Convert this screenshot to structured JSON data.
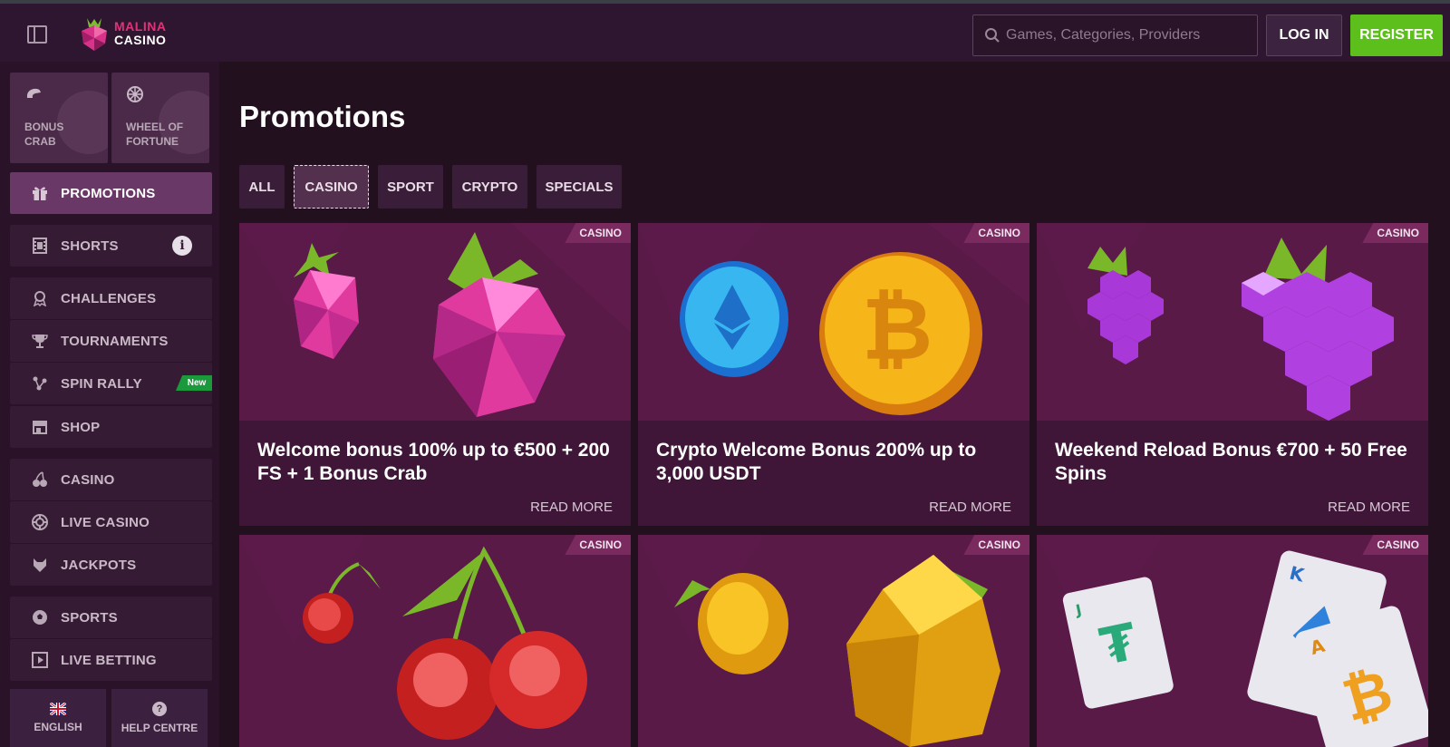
{
  "header": {
    "logo_line1": "MALINA",
    "logo_line2": "CASINO",
    "search_placeholder": "Games, Categories, Providers",
    "login_label": "LOG IN",
    "register_label": "REGISTER"
  },
  "sidebar": {
    "tiles": [
      {
        "label": "BONUS CRAB",
        "icon": "crab-icon"
      },
      {
        "label": "WHEEL OF FORTUNE",
        "icon": "wheel-icon"
      }
    ],
    "items": [
      {
        "label": "PROMOTIONS",
        "icon": "gift-icon",
        "active": true
      },
      {
        "label": "SHORTS",
        "icon": "film-icon",
        "info": "i"
      },
      {
        "label": "CHALLENGES",
        "icon": "award-icon"
      },
      {
        "label": "TOURNAMENTS",
        "icon": "trophy-icon"
      },
      {
        "label": "SPIN RALLY",
        "icon": "rally-icon",
        "badge": "New"
      },
      {
        "label": "SHOP",
        "icon": "shop-icon"
      },
      {
        "label": "CASINO",
        "icon": "cherries-icon"
      },
      {
        "label": "LIVE CASINO",
        "icon": "chip-icon"
      },
      {
        "label": "JACKPOTS",
        "icon": "wolf-icon"
      },
      {
        "label": "SPORTS",
        "icon": "ball-icon"
      },
      {
        "label": "LIVE BETTING",
        "icon": "live-icon"
      }
    ],
    "footer": {
      "language_label": "ENGLISH",
      "help_label": "HELP CENTRE",
      "help_icon_text": "?"
    }
  },
  "main": {
    "title": "Promotions",
    "tabs": [
      {
        "label": "ALL",
        "active": false
      },
      {
        "label": "CASINO",
        "active": true
      },
      {
        "label": "SPORT",
        "active": false
      },
      {
        "label": "CRYPTO",
        "active": false
      },
      {
        "label": "SPECIALS",
        "active": false
      }
    ],
    "cards": [
      {
        "tag": "CASINO",
        "title": "Welcome bonus 100% up to €500 + 200 FS + 1 Bonus Crab",
        "read_more": "READ MORE",
        "art": "raspberries"
      },
      {
        "tag": "CASINO",
        "title": "Crypto Welcome Bonus 200% up to 3,000 USDT",
        "read_more": "READ MORE",
        "art": "crypto-coins"
      },
      {
        "tag": "CASINO",
        "title": "Weekend Reload Bonus €700 + 50 Free Spins",
        "read_more": "READ MORE",
        "art": "grapes"
      },
      {
        "tag": "CASINO",
        "title": "",
        "read_more": "",
        "art": "cherries"
      },
      {
        "tag": "CASINO",
        "title": "",
        "read_more": "",
        "art": "lemons"
      },
      {
        "tag": "CASINO",
        "title": "",
        "read_more": "",
        "art": "cards"
      }
    ]
  },
  "colors": {
    "accent_register": "#5cbf1b",
    "brand_pink": "#e0327a",
    "active_nav": "#6a3866",
    "new_badge": "#1a9a3a"
  }
}
